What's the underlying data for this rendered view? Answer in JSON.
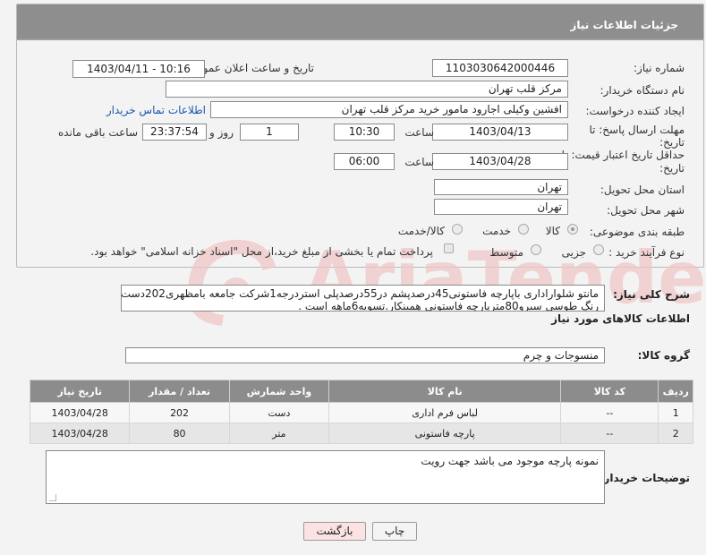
{
  "header": {
    "title": "جزئیات اطلاعات نیاز"
  },
  "labels": {
    "need_number": "شماره نیاز:",
    "announce_datetime": "تاریخ و ساعت اعلان عمومی:",
    "buyer_org": "نام دستگاه خریدار:",
    "requester": "ایجاد کننده درخواست:",
    "contact_link": "اطلاعات تماس خریدار",
    "deadline_send": "مهلت ارسال پاسخ: تا تاریخ:",
    "time": "ساعت",
    "day_and": "روز و",
    "remaining": "ساعت باقی مانده",
    "price_validity": "حداقل تاریخ اعتبار قیمت: تا تاریخ:",
    "time2": "ساعت",
    "province": "استان محل تحویل:",
    "city": "شهر محل تحویل:",
    "category": "طبقه بندی موضوعی:",
    "purchase_type": "نوع فرآیند خرید :",
    "overall_desc": "شرح کلی نیاز:",
    "goods_info": "اطلاعات کالاهای مورد نیاز",
    "goods_group": "گروه کالا:",
    "buyer_notes": "توضیحات خریدار:"
  },
  "values": {
    "need_number": "1103030642000446",
    "announce_datetime": "1403/04/11 - 10:16",
    "buyer_org": "مرکز قلب تهران",
    "requester": "افشین وکیلی اجارود مامور خرید مرکز قلب تهران",
    "deadline_date": "1403/04/13",
    "deadline_time": "10:30",
    "days": "1",
    "remaining_time": "23:37:54",
    "validity_date": "1403/04/28",
    "validity_time": "06:00",
    "province": "تهران",
    "city": "تهران",
    "goods_group": "منسوجات و چرم",
    "overall_desc_line1": "مانتو شلواراداری باپارچه فاستونی45درصدپشم در55درصدپلی استردرجه1شرکت جامعه بامظهری202دست",
    "overall_desc_line2": "رنگ طوسی سیرو80مترپارچه فاستونی همینکار.تسویه6ماهه است .",
    "buyer_notes": "نمونه پارچه موجود می باشد جهت رویت"
  },
  "category_options": [
    {
      "label": "کالا",
      "selected": true
    },
    {
      "label": "خدمت",
      "selected": false
    },
    {
      "label": "کالا/خدمت",
      "selected": false
    }
  ],
  "purchase_options": [
    {
      "label": "جزیی",
      "selected": false
    },
    {
      "label": "متوسط",
      "selected": false
    }
  ],
  "treasury_note": "پرداخت تمام یا بخشی از مبلغ خرید،از محل \"اسناد خزانه اسلامی\" خواهد بود.",
  "table": {
    "headers": [
      "ردیف",
      "کد کالا",
      "نام کالا",
      "واحد شمارش",
      "تعداد / مقدار",
      "تاریخ نیاز"
    ],
    "rows": [
      [
        "1",
        "--",
        "لباس فرم اداری",
        "دست",
        "202",
        "1403/04/28"
      ],
      [
        "2",
        "--",
        "پارچه فاستونی",
        "متر",
        "80",
        "1403/04/28"
      ]
    ]
  },
  "buttons": {
    "print": "چاپ",
    "back": "بازگشت"
  },
  "watermark_text": "AriaTender.neT",
  "colors": {
    "header_bg": "#8e8e8e",
    "link": "#1b57b0",
    "back_btn_bg": "#fbe3e3",
    "watermark": "#f0c7c7"
  }
}
